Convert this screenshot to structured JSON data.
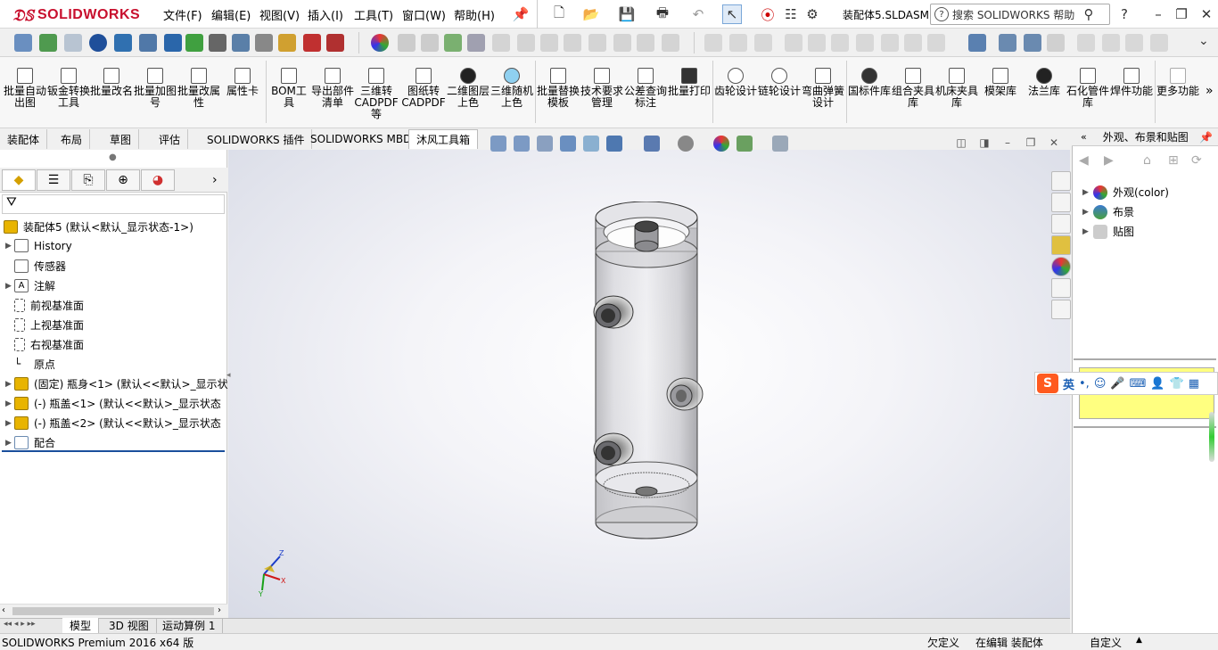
{
  "app": {
    "logo_text": "SOLIDWORKS",
    "document_title": "装配体5.SLDASM"
  },
  "menu": {
    "items": [
      "文件(F)",
      "编辑(E)",
      "视图(V)",
      "插入(I)",
      "工具(T)",
      "窗口(W)",
      "帮助(H)"
    ]
  },
  "search": {
    "placeholder": "搜索 SOLIDWORKS 帮助"
  },
  "command_manager": {
    "buttons": [
      "批量自动出图",
      "钣金转换工具",
      "批量改名",
      "批量加图号",
      "批量改属性",
      "属性卡",
      "BOM工具",
      "导出部件清单",
      "三维转CADPDF等",
      "图纸转CADPDF",
      "二维图层上色",
      "三维随机上色",
      "批量替换模板",
      "技术要求管理",
      "公差查询标注",
      "批量打印",
      "齿轮设计",
      "链轮设计",
      "弯曲弹簧设计",
      "国标件库",
      "组合夹具库",
      "机床夹具库",
      "模架库",
      "法兰库",
      "石化管件库",
      "焊件功能",
      "更多功能"
    ],
    "more": "»"
  },
  "command_tabs": [
    "装配体",
    "布局",
    "草图",
    "评估",
    "SOLIDWORKS 插件",
    "SOLIDWORKS MBD",
    "沐风工具箱"
  ],
  "feature_tree": {
    "root": "装配体5  (默认<默认_显示状态-1>)",
    "items": [
      {
        "label": "History",
        "expand": true
      },
      {
        "label": "传感器",
        "expand": false
      },
      {
        "label": "注解",
        "expand": true
      },
      {
        "label": "前视基准面",
        "expand": false
      },
      {
        "label": "上视基准面",
        "expand": false
      },
      {
        "label": "右视基准面",
        "expand": false
      },
      {
        "label": "原点",
        "expand": false
      },
      {
        "label": "(固定) 瓶身<1> (默认<<默认>_显示状",
        "expand": true
      },
      {
        "label": "(-) 瓶盖<1> (默认<<默认>_显示状态",
        "expand": true
      },
      {
        "label": "(-) 瓶盖<2> (默认<<默认>_显示状态",
        "expand": true
      },
      {
        "label": "配合",
        "expand": true
      }
    ]
  },
  "bottom_tabs": [
    "模型",
    "3D 视图",
    "运动算例 1"
  ],
  "status": {
    "product": "SOLIDWORKS Premium 2016 x64 版",
    "defined": "欠定义",
    "editing": "在编辑 装配体",
    "custom": "自定义"
  },
  "task_pane": {
    "title": "外观、布景和贴图",
    "items": [
      "外观(color)",
      "布景",
      "贴图"
    ]
  },
  "ime": {
    "logo": "S",
    "mode": "英"
  },
  "triad": {
    "x": "X",
    "y": "Y",
    "z": "Z"
  },
  "colors": {
    "brand": "#c8102e",
    "viewport_bg": "#e3e6ee",
    "selection_line": "#1a4f9c",
    "tooltip_bg": "#ffff80"
  }
}
